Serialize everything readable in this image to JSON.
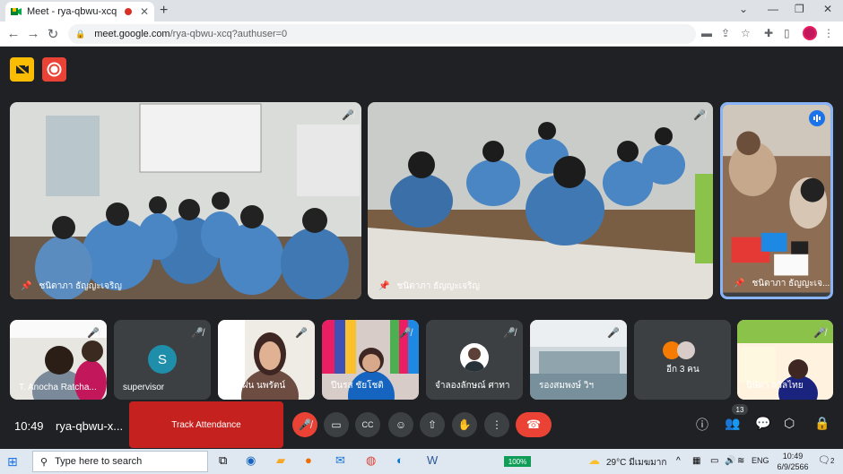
{
  "browser": {
    "tab_title": "Meet - rya-qbwu-xcq",
    "url_host": "meet.google.com",
    "url_path": "/rya-qbwu-xcq?authuser=0"
  },
  "meet": {
    "main_tiles": [
      {
        "name": "ชนิดาภา ธัญญะเจริญ"
      },
      {
        "name": "ชนิดาภา ธัญญะเจริญ"
      },
      {
        "name": "ชนิดาภา ธัญญะเจ..."
      }
    ],
    "small_tiles": [
      {
        "name": "T. Anocha Ratcha..."
      },
      {
        "name": "supervisor",
        "avatar_letter": "S"
      },
      {
        "name": "สายฝน นพรัตน์"
      },
      {
        "name": "ปีนรส ชัยโชติ"
      },
      {
        "name": "จำลองลักษณ์ ศาทา"
      },
      {
        "name": "รองสมพงษ์ วิฯ"
      },
      {
        "name": "อีก 3 คน"
      },
      {
        "name": "นิษัดา ถวิลไทย"
      }
    ],
    "clock": "10:49",
    "meeting_code": "rya-qbwu-x...",
    "attendance_label": "Track Attendance",
    "participant_count": "13"
  },
  "taskbar": {
    "search_placeholder": "Type here to search",
    "battery": "100%",
    "weather": "29°C มีเมฆมาก",
    "language": "ENG",
    "time": "10:49",
    "date": "6/9/2566",
    "notifications": "2"
  },
  "colors": {
    "meet_bg": "#202124",
    "hangup_red": "#ea4335",
    "attendance_red": "#c5221f",
    "active_speaker": "#8ab4f8"
  }
}
